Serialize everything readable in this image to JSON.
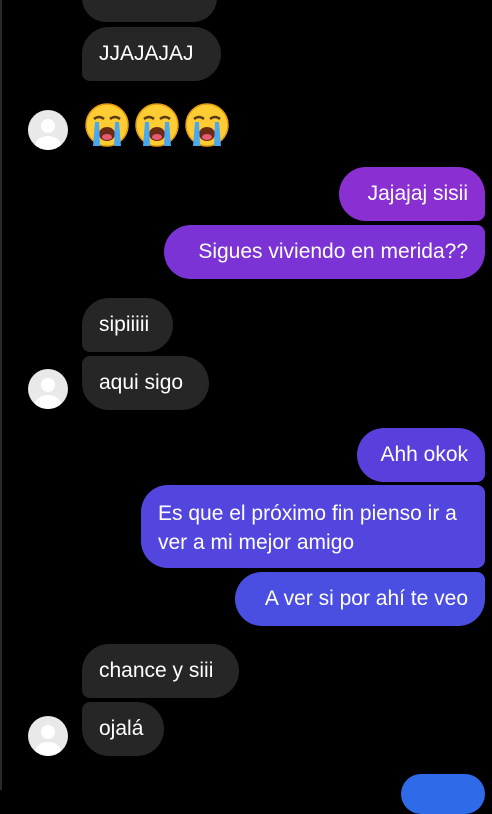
{
  "messages": [
    {
      "id": "m1",
      "side": "in",
      "text": "JJAJAJAJ"
    },
    {
      "id": "m2",
      "side": "in",
      "text": "😭😭😭",
      "emoji": "loudly-crying-face"
    },
    {
      "id": "m3",
      "side": "out",
      "text": "Jajajaj sisii"
    },
    {
      "id": "m4",
      "side": "out",
      "text": "Sigues viviendo en merida??"
    },
    {
      "id": "m5",
      "side": "in",
      "text": "sipiiiii"
    },
    {
      "id": "m6",
      "side": "in",
      "text": "aqui sigo"
    },
    {
      "id": "m7",
      "side": "out",
      "text": "Ahh okok"
    },
    {
      "id": "m8",
      "side": "out",
      "text": "Es que el próximo fin pienso ir a ver a mi mejor amigo"
    },
    {
      "id": "m9",
      "side": "out",
      "text": "A ver si por ahí te veo"
    },
    {
      "id": "m10",
      "side": "in",
      "text": "chance y siii"
    },
    {
      "id": "m11",
      "side": "in",
      "text": "ojalá"
    }
  ],
  "colors": {
    "background": "#000000",
    "incoming_bubble": "#262626",
    "outgoing_gradient_top": "#8a2fd1",
    "outgoing_gradient_bottom": "#2f6be8",
    "text": "#ffffff"
  },
  "icons": {
    "avatar": "default-profile-avatar-icon",
    "emoji": "loudly-crying-face-emoji"
  }
}
